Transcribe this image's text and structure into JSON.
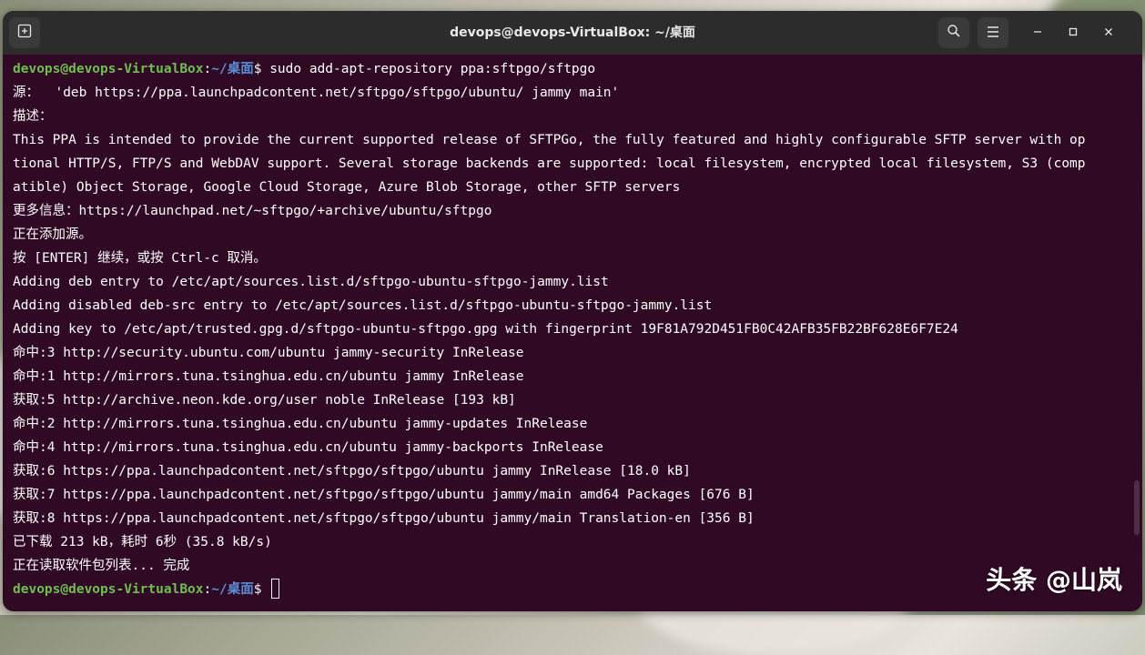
{
  "window": {
    "title": "devops@devops-VirtualBox: ~/桌面",
    "new_tab_icon": "new-tab-icon",
    "search_icon": "search-icon",
    "menu_icon": "hamburger-menu-icon",
    "minimize_icon": "minimize-icon",
    "maximize_icon": "maximize-icon",
    "close_icon": "close-icon"
  },
  "prompt": {
    "user_host": "devops@devops-VirtualBox",
    "separator": ":",
    "path": "~/桌面",
    "symbol": "$ "
  },
  "terminal": {
    "command": "sudo add-apt-repository ppa:sftpgo/sftpgo",
    "lines": [
      "源：  'deb https://ppa.launchpadcontent.net/sftpgo/sftpgo/ubuntu/ jammy main'",
      "描述：",
      "This PPA is intended to provide the current supported release of SFTPGo, the fully featured and highly configurable SFTP server with op",
      "tional HTTP/S, FTP/S and WebDAV support. Several storage backends are supported: local filesystem, encrypted local filesystem, S3 (comp",
      "atible) Object Storage, Google Cloud Storage, Azure Blob Storage, other SFTP servers",
      "更多信息：https://launchpad.net/~sftpgo/+archive/ubuntu/sftpgo",
      "正在添加源。",
      "按 [ENTER] 继续，或按 Ctrl-c 取消。",
      "Adding deb entry to /etc/apt/sources.list.d/sftpgo-ubuntu-sftpgo-jammy.list",
      "Adding disabled deb-src entry to /etc/apt/sources.list.d/sftpgo-ubuntu-sftpgo-jammy.list",
      "Adding key to /etc/apt/trusted.gpg.d/sftpgo-ubuntu-sftpgo.gpg with fingerprint 19F81A792D451FB0C42AFB35FB22BF628E6F7E24",
      "命中:3 http://security.ubuntu.com/ubuntu jammy-security InRelease",
      "命中:1 http://mirrors.tuna.tsinghua.edu.cn/ubuntu jammy InRelease",
      "获取:5 http://archive.neon.kde.org/user noble InRelease [193 kB]",
      "命中:2 http://mirrors.tuna.tsinghua.edu.cn/ubuntu jammy-updates InRelease",
      "命中:4 http://mirrors.tuna.tsinghua.edu.cn/ubuntu jammy-backports InRelease",
      "获取:6 https://ppa.launchpadcontent.net/sftpgo/sftpgo/ubuntu jammy InRelease [18.0 kB]",
      "获取:7 https://ppa.launchpadcontent.net/sftpgo/sftpgo/ubuntu jammy/main amd64 Packages [676 B]",
      "获取:8 https://ppa.launchpadcontent.net/sftpgo/sftpgo/ubuntu jammy/main Translation-en [356 B]",
      "已下载 213 kB，耗时 6秒 (35.8 kB/s)",
      "正在读取软件包列表... 完成"
    ]
  },
  "watermark": "头条 @山岚",
  "colors": {
    "terminal_bg": "#300a24",
    "titlebar_bg": "#2c2c2c",
    "prompt_user": "#6fbf4f",
    "prompt_path": "#5a8fd8"
  }
}
